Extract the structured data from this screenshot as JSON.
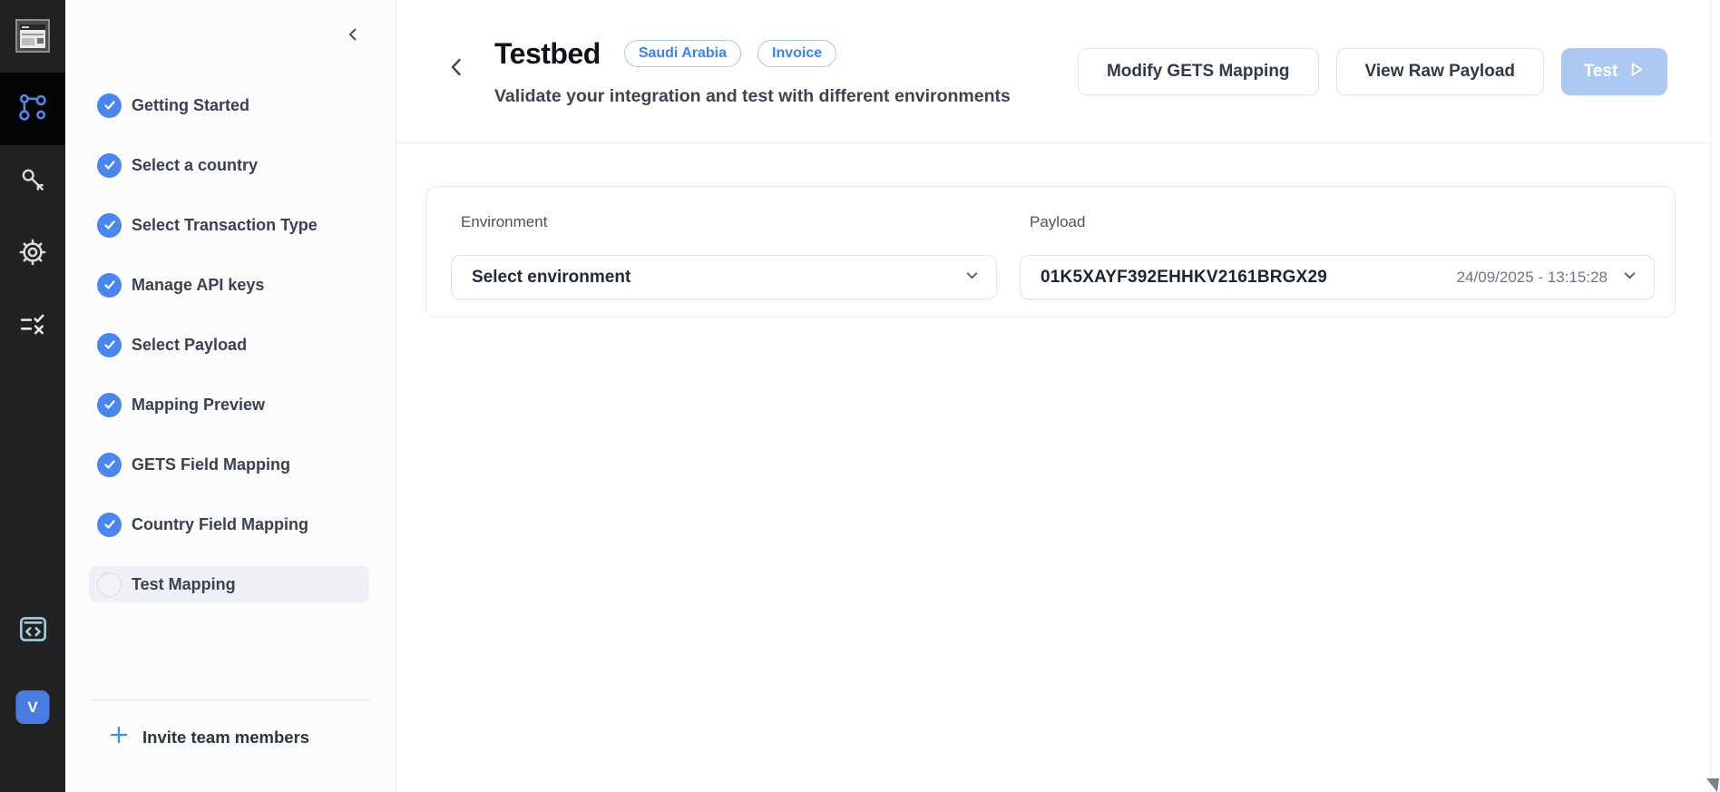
{
  "rail": {
    "avatar": "V"
  },
  "sidebar": {
    "steps": [
      {
        "label": "Getting Started",
        "state": "done"
      },
      {
        "label": "Select a country",
        "state": "done"
      },
      {
        "label": "Select Transaction Type",
        "state": "done"
      },
      {
        "label": "Manage API keys",
        "state": "done"
      },
      {
        "label": "Select Payload",
        "state": "done"
      },
      {
        "label": "Mapping Preview",
        "state": "done"
      },
      {
        "label": "GETS Field Mapping",
        "state": "done"
      },
      {
        "label": "Country Field Mapping",
        "state": "done"
      },
      {
        "label": "Test Mapping",
        "state": "current"
      }
    ],
    "invite": "Invite team members"
  },
  "header": {
    "title": "Testbed",
    "badges": [
      "Saudi Arabia",
      "Invoice"
    ],
    "subtitle": "Validate your integration and test with different environments",
    "modify_button": "Modify GETS Mapping",
    "view_raw_button": "View Raw Payload",
    "test_button": "Test"
  },
  "form": {
    "environment_label": "Environment",
    "environment_placeholder": "Select environment",
    "payload_label": "Payload",
    "payload_value": "01K5XAYF392EHHKV2161BRGX29",
    "payload_timestamp": "24/09/2025 - 13:15:28"
  },
  "icons": {
    "rail": [
      "workflow-icon",
      "key-icon",
      "gear-icon",
      "list-check-icon",
      "code-window-icon"
    ]
  },
  "colors": {
    "accent_blue": "#4b85ee",
    "badge_blue": "#3c82f0",
    "test_button_bg": "#abc9f2",
    "rail_bg": "#212224",
    "avatar_bg": "#4a7be0"
  }
}
